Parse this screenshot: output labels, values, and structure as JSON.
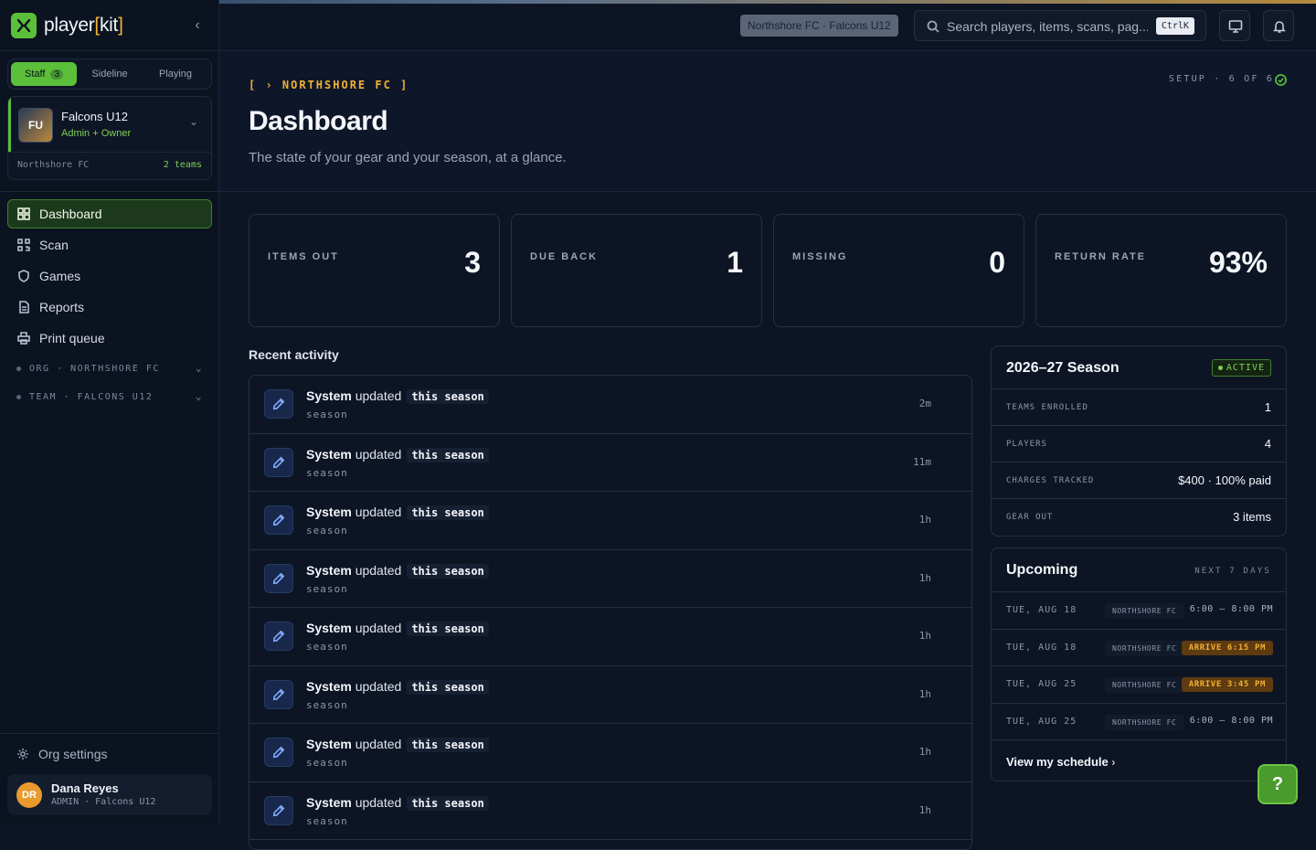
{
  "brand": {
    "name": "player",
    "bracket_open": "[",
    "bracket_word": "kit",
    "bracket_close": "]"
  },
  "modes": [
    {
      "label": "Staff",
      "count": "3"
    },
    {
      "label": "Sideline"
    },
    {
      "label": "Playing"
    }
  ],
  "team_card": {
    "initials": "FU",
    "name": "Falcons U12",
    "role": "Admin + Owner",
    "org": "Northshore FC",
    "teams": "2 teams"
  },
  "nav": [
    {
      "label": "Dashboard",
      "icon": "grid-icon"
    },
    {
      "label": "Scan",
      "icon": "qr-icon"
    },
    {
      "label": "Games",
      "icon": "shield-icon"
    },
    {
      "label": "Reports",
      "icon": "document-icon"
    },
    {
      "label": "Print queue",
      "icon": "printer-icon"
    }
  ],
  "groups": [
    {
      "label": "ORG · NORTHSHORE FC"
    },
    {
      "label": "TEAM · FALCONS U12"
    }
  ],
  "org_settings": "Org settings",
  "user": {
    "initials": "DR",
    "name": "Dana Reyes",
    "role": "ADMIN · Falcons U12"
  },
  "topbar": {
    "context": "Northshore FC · Falcons U12",
    "search_placeholder": "Search players, items, scans, pag...",
    "shortcut": "CtrlK"
  },
  "header": {
    "eyebrow": "[ › NORTHSHORE FC ]",
    "title": "Dashboard",
    "subtitle": "The state of your gear and your season, at a glance.",
    "setup": "SETUP · 6 OF 6"
  },
  "stats": [
    {
      "label": "ITEMS OUT",
      "value": "3"
    },
    {
      "label": "DUE BACK",
      "value": "1"
    },
    {
      "label": "MISSING",
      "value": "0"
    },
    {
      "label": "RETURN RATE",
      "value": "93%"
    }
  ],
  "activity": {
    "title": "Recent activity",
    "rows": [
      {
        "actor": "System",
        "verb": "updated",
        "target": "this season",
        "sub": "season",
        "time": "2m"
      },
      {
        "actor": "System",
        "verb": "updated",
        "target": "this season",
        "sub": "season",
        "time": "11m"
      },
      {
        "actor": "System",
        "verb": "updated",
        "target": "this season",
        "sub": "season",
        "time": "1h"
      },
      {
        "actor": "System",
        "verb": "updated",
        "target": "this season",
        "sub": "season",
        "time": "1h"
      },
      {
        "actor": "System",
        "verb": "updated",
        "target": "this season",
        "sub": "season",
        "time": "1h"
      },
      {
        "actor": "System",
        "verb": "updated",
        "target": "this season",
        "sub": "season",
        "time": "1h"
      },
      {
        "actor": "System",
        "verb": "updated",
        "target": "this season",
        "sub": "season",
        "time": "1h"
      },
      {
        "actor": "System",
        "verb": "updated",
        "target": "this season",
        "sub": "season",
        "time": "1h"
      }
    ]
  },
  "season": {
    "title": "2026–27 Season",
    "status": "ACTIVE",
    "rows": [
      {
        "k": "TEAMS ENROLLED",
        "v": "1"
      },
      {
        "k": "PLAYERS",
        "v": "4"
      },
      {
        "k": "CHARGES TRACKED",
        "v": "$400 · 100% paid"
      },
      {
        "k": "GEAR OUT",
        "v": "3 items"
      }
    ]
  },
  "upcoming": {
    "title": "Upcoming",
    "range": "NEXT 7 DAYS",
    "events": [
      {
        "date": "TUE, AUG 18",
        "org": "NORTHSHORE FC",
        "time": "6:00 – 8:00 PM",
        "arrive": ""
      },
      {
        "date": "TUE, AUG 18",
        "org": "NORTHSHORE FC",
        "time": "",
        "arrive": "ARRIVE 6:15 PM"
      },
      {
        "date": "TUE, AUG 25",
        "org": "NORTHSHORE FC",
        "time": "",
        "arrive": "ARRIVE 3:45 PM"
      },
      {
        "date": "TUE, AUG 25",
        "org": "NORTHSHORE FC",
        "time": "6:00 – 8:00 PM",
        "arrive": ""
      }
    ],
    "link": "View my schedule"
  },
  "help": "?",
  "colors": {
    "accent": "#5bbf3a",
    "brand_bracket": "#f2b134",
    "background": "#0d1525",
    "arrive_badge": "#5e3b10"
  }
}
